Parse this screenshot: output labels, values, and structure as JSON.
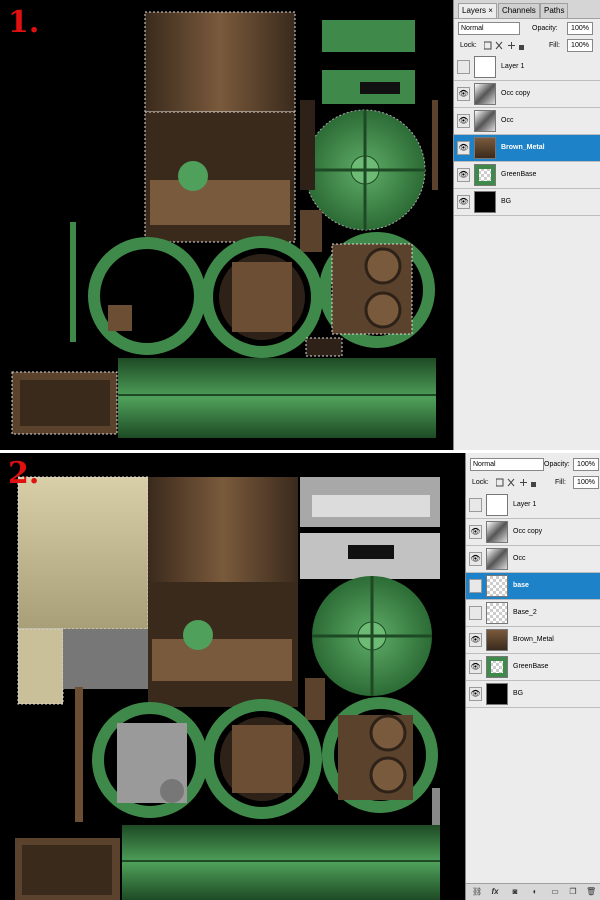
{
  "steps": [
    {
      "number": "1.",
      "panel": {
        "tabs": [
          {
            "label": "Layers ×",
            "active": true
          },
          {
            "label": "Channels",
            "active": false
          },
          {
            "label": "Paths",
            "active": false
          }
        ],
        "blend_mode": "Normal",
        "opacity_label": "Opacity:",
        "opacity_value": "100%",
        "lock_label": "Lock:",
        "fill_label": "Fill:",
        "fill_value": "100%",
        "layers": [
          {
            "name": "Layer 1",
            "visible": false,
            "selected": false,
            "thumb": "white"
          },
          {
            "name": "Occ copy",
            "visible": true,
            "selected": false,
            "thumb": "occ"
          },
          {
            "name": "Occ",
            "visible": true,
            "selected": false,
            "thumb": "occ"
          },
          {
            "name": "Brown_Metal",
            "visible": true,
            "selected": true,
            "thumb": "brown"
          },
          {
            "name": "GreenBase",
            "visible": true,
            "selected": false,
            "thumb": "green"
          },
          {
            "name": "BG",
            "visible": true,
            "selected": false,
            "thumb": "black"
          }
        ]
      }
    },
    {
      "number": "2.",
      "panel": {
        "tabs": [],
        "blend_mode": "Normal",
        "opacity_label": "Opacity:",
        "opacity_value": "100%",
        "lock_label": "Lock:",
        "fill_label": "Fill:",
        "fill_value": "100%",
        "layers": [
          {
            "name": "Layer 1",
            "visible": false,
            "selected": false,
            "thumb": "white"
          },
          {
            "name": "Occ copy",
            "visible": true,
            "selected": false,
            "thumb": "occ"
          },
          {
            "name": "Occ",
            "visible": true,
            "selected": false,
            "thumb": "occ"
          },
          {
            "name": "base",
            "visible": false,
            "selected": true,
            "thumb": "checker"
          },
          {
            "name": "Base_2",
            "visible": false,
            "selected": false,
            "thumb": "checker"
          },
          {
            "name": "Brown_Metal",
            "visible": true,
            "selected": false,
            "thumb": "brown"
          },
          {
            "name": "GreenBase",
            "visible": true,
            "selected": false,
            "thumb": "green"
          },
          {
            "name": "BG",
            "visible": true,
            "selected": false,
            "thumb": "black"
          }
        ],
        "footer_icons": [
          "link-icon",
          "fx-icon",
          "mask-icon",
          "adjustment-icon",
          "folder-icon",
          "new-layer-icon",
          "trash-icon"
        ]
      }
    }
  ],
  "colors": {
    "green": "#3f8a4a",
    "dark_green": "#1d4a24",
    "brown": "#6b4e34",
    "dark_brown": "#2e2218",
    "cream": "#d8cfa8",
    "selection": "#1e82c8",
    "red_label": "#e01010"
  }
}
